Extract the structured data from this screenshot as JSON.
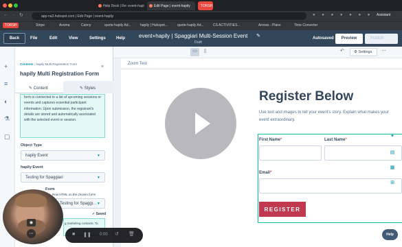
{
  "browser": {
    "tabs": [
      {
        "label": "Help Desk | Re: event-hapi"
      },
      {
        "label": "Edit Page | event-hapily",
        "active": true
      },
      {
        "label": "TORSH"
      }
    ],
    "url": "app-na2.hubspot.com | Edit Page | event-hapily",
    "bookmarks": [
      "TORSH",
      "Stripe",
      "Avoma",
      "Canny",
      "quote-hapily Ad...",
      "hapily | Hubspot...",
      "quote-hapily Ad...",
      "CS ACTIVITIES...",
      "Arrows - Plans",
      "Time Converter"
    ],
    "assistant": "Assistant"
  },
  "header": {
    "back": "Back",
    "menus": [
      "File",
      "Edit",
      "View",
      "Settings",
      "Help"
    ],
    "title": "event+hapily | Spaggiari Multi-Session Event",
    "status": "Draft",
    "autosaved": "Autosaved",
    "preview": "Preview",
    "publish": "Publish"
  },
  "panel": {
    "breadcrumb_root": "Contents",
    "breadcrumb_leaf": "hapily Multi Registration Form",
    "title": "hapily Multi Registration Form",
    "tab_content": "Content",
    "tab_styles": "Styles",
    "help_text": "form is connected to a list of upcoming sessions or events and captures essential participant information. Upon submission, the registrant's details are stored and automatically associated with the selected event or session.",
    "object_type_label": "Object Type",
    "object_type_value": "hapily Event",
    "event_label": "hapily Event",
    "event_value": "Testing for Spaggiari",
    "form_label": "Form",
    "form_hint": "Row HTML on the chosen form!",
    "form_value": "Testing for Spaggi...",
    "saved": "Saved",
    "marketing_hint": "g marketing contacts. To"
  },
  "canvas": {
    "settings": "Settings",
    "zoom_text": "Zoom Test",
    "register_title": "Register Below",
    "register_sub": "Use text and images to tell your event's story. Explain what makes your event extraordinary.",
    "first_name": "First Name",
    "last_name": "Last Name",
    "email": "Email",
    "required": "*",
    "register_button": "REGISTER"
  },
  "recorder": {
    "time": "0:00"
  },
  "help_button": "Help",
  "colors": {
    "hubspot_nav": "#33475b",
    "accent_teal": "#00bda5",
    "register_button": "#c0394f"
  }
}
